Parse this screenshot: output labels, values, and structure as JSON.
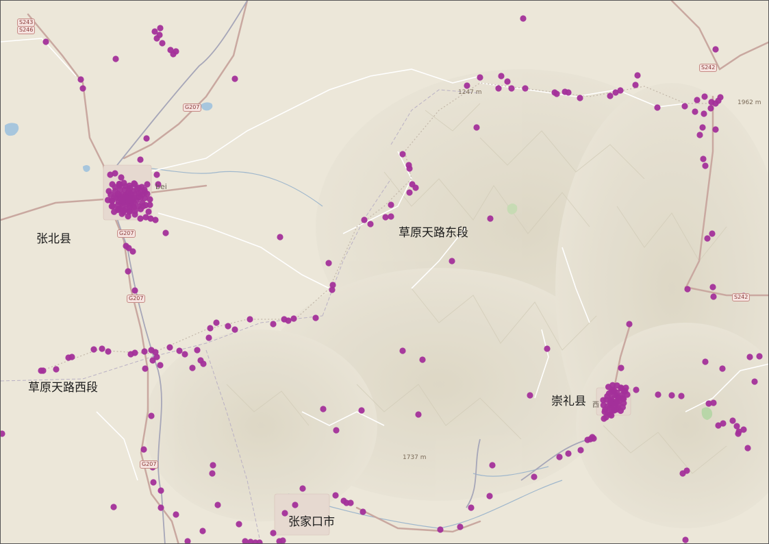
{
  "map": {
    "labels": {
      "zhangbei_county": "张北县",
      "grassland_west": "草原天路西段",
      "grassland_east": "草原天路东段",
      "chongli_county": "崇礼县",
      "zhangjiakou_city": "张家口市",
      "town_bei": "bei",
      "town_xi": "西"
    },
    "road_shields": {
      "s243": "S243",
      "s246": "S246",
      "g207_a": "G207",
      "g207_b": "G207",
      "g207_c": "G207",
      "g207_d": "G207",
      "s242": "S242",
      "s242_b": "S242"
    },
    "elevations": {
      "e1": "1247 m",
      "e2": "1737 m",
      "e3": "1962 m"
    },
    "colors": {
      "point": "#a3309a",
      "land": "#ece7d9",
      "mountain": "#e4dfcf",
      "road_major": "#c9a8a0",
      "road_minor": "#ffffff",
      "water": "#a7c6dd",
      "river": "#9fb7cc",
      "boundary": "#b9b0c4"
    }
  }
}
